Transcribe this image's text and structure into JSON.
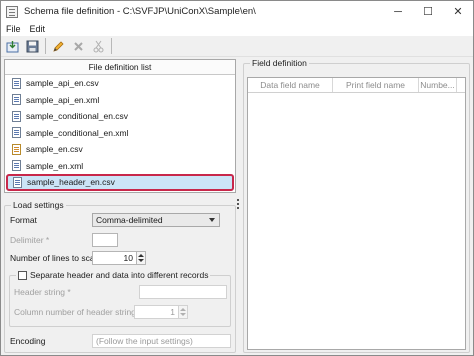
{
  "window": {
    "title": "Schema file definition - C:\\SVFJP\\UniConX\\Sample\\en\\",
    "controls": {
      "minimize": "─",
      "maximize": "☐",
      "close": "✕"
    }
  },
  "menu": [
    "File",
    "Edit"
  ],
  "toolbar": {
    "buttons": [
      "import-icon",
      "save-icon",
      "edit-icon",
      "delete-icon",
      "cut-icon"
    ]
  },
  "file_list": {
    "header": "File definition list",
    "items": [
      {
        "name": "sample_api_en.csv",
        "icon": "file-icon"
      },
      {
        "name": "sample_api_en.xml",
        "icon": "file-icon"
      },
      {
        "name": "sample_conditional_en.csv",
        "icon": "file-icon"
      },
      {
        "name": "sample_conditional_en.xml",
        "icon": "file-icon"
      },
      {
        "name": "sample_en.csv",
        "icon": "file-icon-alt"
      },
      {
        "name": "sample_en.xml",
        "icon": "file-icon"
      },
      {
        "name": "sample_header_en.csv",
        "icon": "file-icon",
        "selected": true
      }
    ]
  },
  "load_settings": {
    "title": "Load settings",
    "format_label": "Format",
    "format_value": "Comma-delimited",
    "delimiter_label": "Delimiter *",
    "delimiter_value": "",
    "lines_label": "Number of lines to scan",
    "lines_value": "10",
    "separate_label": "Separate header and data into different records",
    "separate_checked": false,
    "header_string_label": "Header string *",
    "header_string_value": "",
    "column_number_label": "Column number of header string",
    "column_number_value": "1",
    "encoding_label": "Encoding",
    "encoding_value": "(Follow the input settings)"
  },
  "field_definition": {
    "title": "Field definition",
    "columns": [
      "Data field name",
      "Print field name",
      "Numbe..."
    ]
  },
  "colors": {
    "selection_bg": "#cce4f7",
    "selection_outline": "#c8274a"
  }
}
